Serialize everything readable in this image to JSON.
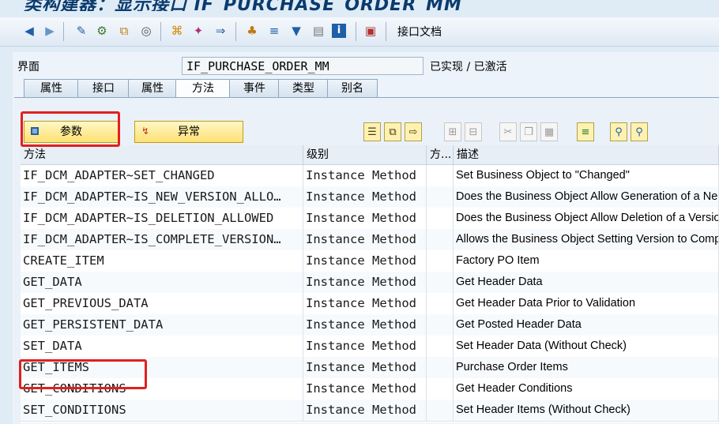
{
  "window_title": "类构建器：显示接口 IF_PURCHASE_ORDER_MM",
  "toolbar": {
    "icons": [
      "back-icon",
      "forward-icon",
      "toggle-icon",
      "object-list-icon",
      "display-change-icon",
      "activate-icon",
      "check-icon",
      "where-used-icon",
      "hierarchy-icon",
      "magic-wand-icon",
      "navigate-icon",
      "tree-icon",
      "stack-icon",
      "filter-icon",
      "frame-icon",
      "info-icon",
      "doc-icon"
    ],
    "doc_label": "接口文档"
  },
  "interface_label": "界面",
  "interface_value": "IF_PURCHASE_ORDER_MM",
  "status_text": "已实现 / 已激活",
  "tabs": [
    {
      "label": "属性"
    },
    {
      "label": "接口"
    },
    {
      "label": "属性"
    },
    {
      "label": "方法",
      "active": true
    },
    {
      "label": "事件"
    },
    {
      "label": "类型"
    },
    {
      "label": "别名"
    }
  ],
  "buttons": {
    "params_label": "参数",
    "exceptions_label": "异常"
  },
  "table": {
    "headers": [
      "方法",
      "级别",
      "方...",
      "描述"
    ],
    "rows": [
      {
        "method": "IF_DCM_ADAPTER~SET_CHANGED",
        "level": "Instance Method",
        "desc": "Set Business Object to \"Changed\""
      },
      {
        "method": "IF_DCM_ADAPTER~IS_NEW_VERSION_ALLO…",
        "level": "Instance Method",
        "desc": "Does the Business Object Allow Generation of a Ne"
      },
      {
        "method": "IF_DCM_ADAPTER~IS_DELETION_ALLOWED",
        "level": "Instance Method",
        "desc": "Does the Business Object Allow Deletion of a Versio"
      },
      {
        "method": "IF_DCM_ADAPTER~IS_COMPLETE_VERSION…",
        "level": "Instance Method",
        "desc": "Allows the Business Object Setting Version to Comp"
      },
      {
        "method": "CREATE_ITEM",
        "level": "Instance Method",
        "desc": "Factory PO Item"
      },
      {
        "method": "GET_DATA",
        "level": "Instance Method",
        "desc": "Get Header Data"
      },
      {
        "method": "GET_PREVIOUS_DATA",
        "level": "Instance Method",
        "desc": "Get Header Data Prior to Validation"
      },
      {
        "method": "GET_PERSISTENT_DATA",
        "level": "Instance Method",
        "desc": "Get Posted Header Data"
      },
      {
        "method": "SET_DATA",
        "level": "Instance Method",
        "desc": "Set Header Data (Without Check)"
      },
      {
        "method": "GET_ITEMS",
        "level": "Instance Method",
        "desc": "Purchase Order Items"
      },
      {
        "method": "GET_CONDITIONS",
        "level": "Instance Method",
        "desc": "Get Header Conditions"
      },
      {
        "method": "SET_CONDITIONS",
        "level": "Instance Method",
        "desc": "Set Header Items (Without Check)"
      }
    ]
  },
  "colors": {
    "highlight": "#e02020",
    "button_fill": "#fde172"
  }
}
